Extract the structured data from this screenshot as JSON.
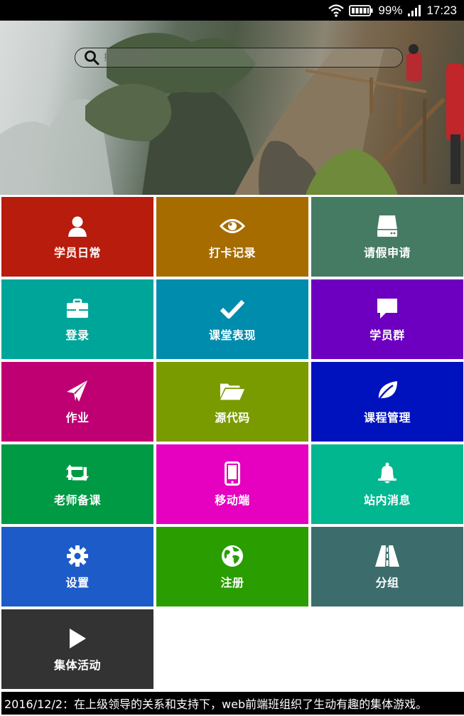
{
  "status_bar": {
    "battery": "99%",
    "time": "17:23"
  },
  "search": {
    "placeholder": "搜索关键字"
  },
  "carousel": {
    "dot_count": 7
  },
  "tiles": [
    {
      "label": "学员日常",
      "icon": "user-icon",
      "color": "#b71c0c"
    },
    {
      "label": "打卡记录",
      "icon": "eye-icon",
      "color": "#a66c00"
    },
    {
      "label": "请假申请",
      "icon": "hard-drive-icon",
      "color": "#457b63"
    },
    {
      "label": "登录",
      "icon": "briefcase-icon",
      "color": "#00a59a"
    },
    {
      "label": "课堂表现",
      "icon": "checkmark-icon",
      "color": "#008cad"
    },
    {
      "label": "学员群",
      "icon": "chat-bubble-icon",
      "color": "#6d00c0"
    },
    {
      "label": "作业",
      "icon": "paper-plane-icon",
      "color": "#bf0073"
    },
    {
      "label": "源代码",
      "icon": "folder-open-icon",
      "color": "#7a9b00"
    },
    {
      "label": "课程管理",
      "icon": "leaf-icon",
      "color": "#0012be"
    },
    {
      "label": "老师备课",
      "icon": "retweet-icon",
      "color": "#009a44"
    },
    {
      "label": "移动端",
      "icon": "mobile-phone-icon",
      "color": "#e600bf"
    },
    {
      "label": "站内消息",
      "icon": "bell-icon",
      "color": "#00b790"
    },
    {
      "label": "设置",
      "icon": "gear-icon",
      "color": "#1d5bc8"
    },
    {
      "label": "注册",
      "icon": "globe-icon",
      "color": "#2a9e00"
    },
    {
      "label": "分组",
      "icon": "road-icon",
      "color": "#3d6c6c"
    },
    {
      "label": "集体活动",
      "icon": "play-icon",
      "color": "#333333"
    }
  ],
  "news": {
    "text": "2016/12/2：在上级领导的关系和支持下，web前端班组织了生动有趣的集体游戏。"
  }
}
